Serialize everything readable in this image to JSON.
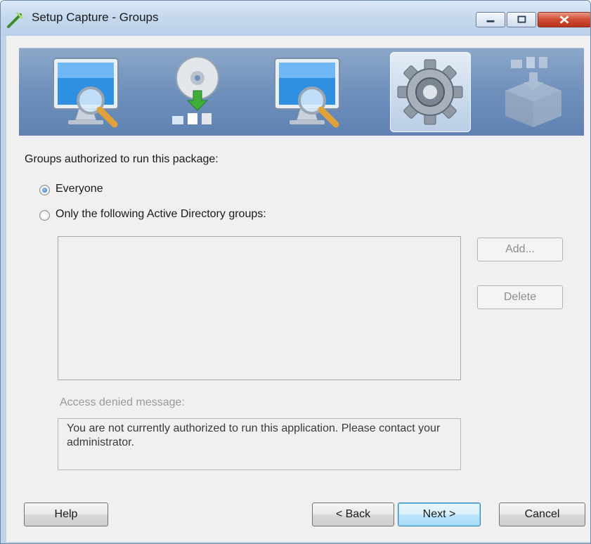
{
  "window": {
    "title": "Setup Capture - Groups"
  },
  "wizard_steps": [
    {
      "icon": "monitor-magnifier-icon",
      "state": "done"
    },
    {
      "icon": "disc-install-icon",
      "state": "done"
    },
    {
      "icon": "monitor-magnifier-icon",
      "state": "done"
    },
    {
      "icon": "gear-icon",
      "state": "active"
    },
    {
      "icon": "package-box-icon",
      "state": "pending"
    }
  ],
  "groups": {
    "heading": "Groups authorized to run this package:",
    "options": [
      {
        "label": "Everyone",
        "checked": true
      },
      {
        "label": "Only the following Active Directory groups:",
        "checked": false
      }
    ],
    "list_items": [],
    "add_label": "Add...",
    "delete_label": "Delete",
    "access_denied_label": "Access denied message:",
    "access_denied_text": "You are not currently authorized to run this application. Please contact your administrator."
  },
  "buttons": {
    "help": "Help",
    "back": "< Back",
    "next": "Next >",
    "cancel": "Cancel"
  },
  "colors": {
    "banner": "#6f90bc",
    "accent": "#3c7fb1",
    "close": "#cf4b32"
  }
}
